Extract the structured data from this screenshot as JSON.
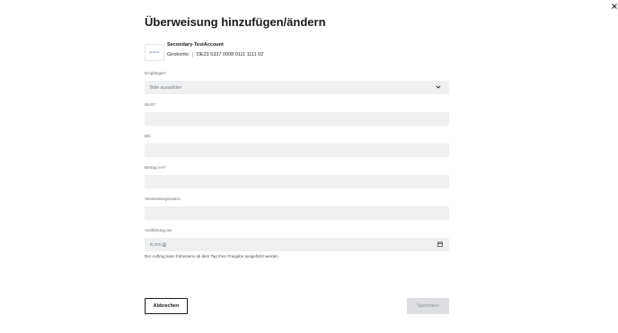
{
  "dialog": {
    "title": "Überweisung hinzufügen/ändern",
    "close_icon": "close-icon"
  },
  "account": {
    "logo_text": "girokonto",
    "name": "Secondary-TestAccount",
    "type": "Girokonto",
    "iban": "DE23 5337 0008 0111 1111 02"
  },
  "fields": {
    "recipient": {
      "label": "Empfänger*",
      "value": "Bitte auswählen",
      "icon": "chevron-down-icon"
    },
    "iban": {
      "label": "IBAN*",
      "value": ""
    },
    "bic": {
      "label": "BIC",
      "value": ""
    },
    "amount": {
      "label": "Betrag in €*",
      "value": ""
    },
    "purpose": {
      "label": "Verwendungszweck",
      "value": ""
    },
    "execution_date": {
      "label": "Ausführung am",
      "placeholder": "tt.mm.jjjj",
      "icon": "calendar-icon"
    }
  },
  "hint": "Der Auftrag kann frühestens ab dem Tag Ihrer Freigabe ausgeführt werden.",
  "actions": {
    "cancel_label": "Abbrechen",
    "save_label": "Speichern"
  }
}
